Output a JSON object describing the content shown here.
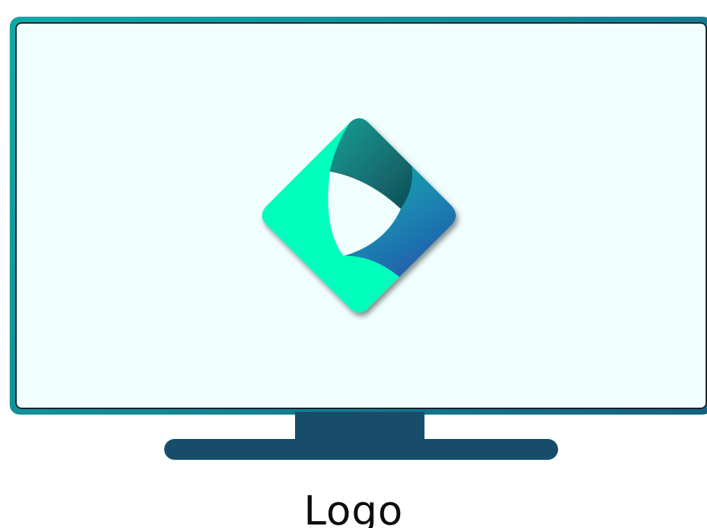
{
  "caption": {
    "text": "Logo"
  },
  "colors": {
    "frame": "#138b97",
    "screen": "#f0fefe",
    "stand": "#174d6b",
    "logo_primary": "#06ffbd",
    "logo_teal": "#1aa79a",
    "logo_blue": "#2458b0",
    "caption": "#0d0d0d"
  },
  "logo": {
    "icon": "diamond-logo-icon"
  }
}
